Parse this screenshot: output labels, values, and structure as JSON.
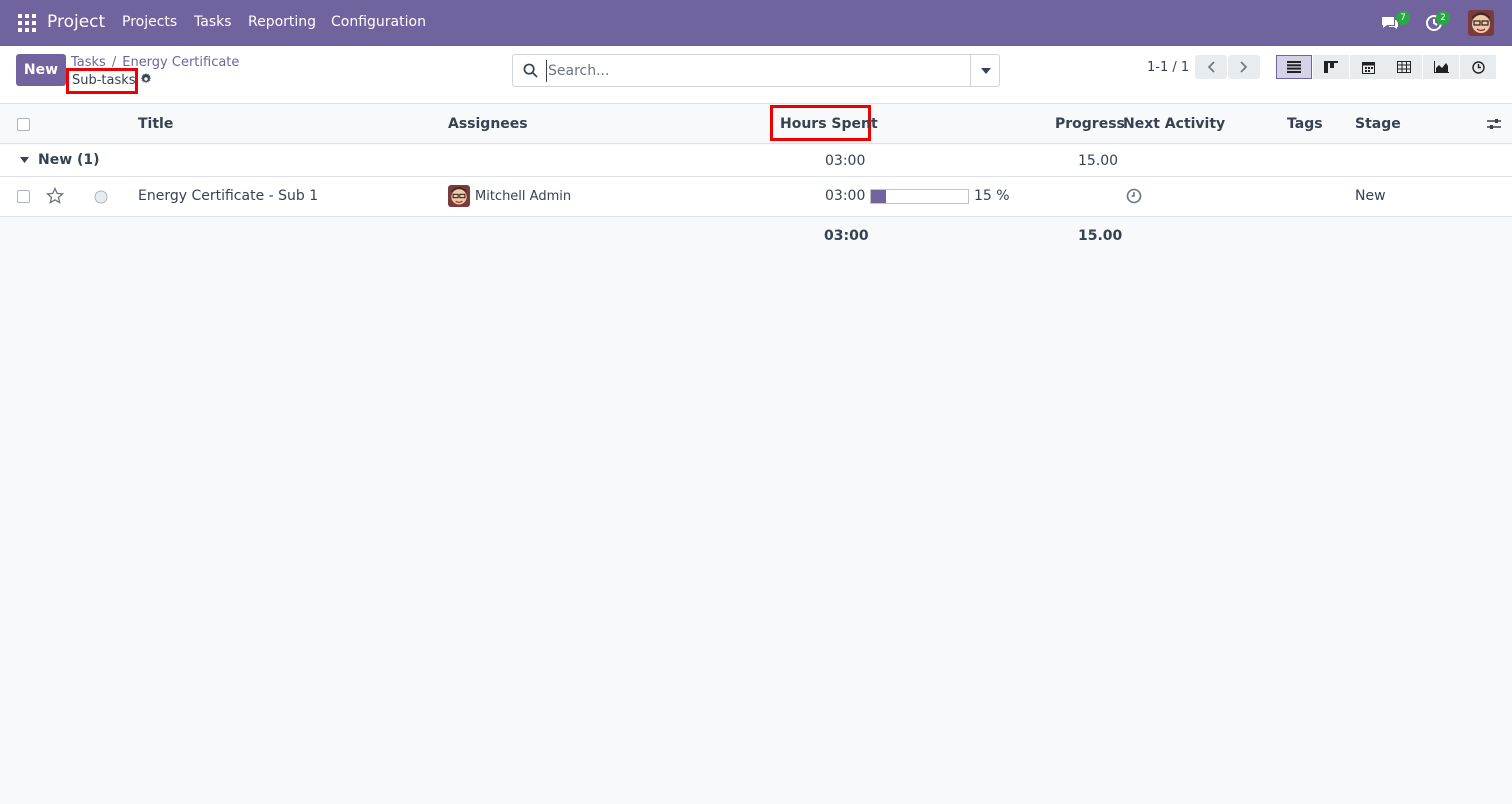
{
  "navbar": {
    "brand": "Project",
    "menu": [
      "Projects",
      "Tasks",
      "Reporting",
      "Configuration"
    ],
    "messages_count": "7",
    "activities_count": "2"
  },
  "control_panel": {
    "new_label": "New",
    "breadcrumb": [
      "Tasks",
      "Energy Certificate"
    ],
    "current": "Sub-tasks",
    "search_placeholder": "Search...",
    "pager": "1-1 / 1"
  },
  "list": {
    "columns": {
      "title": "Title",
      "assignees": "Assignees",
      "hours_spent": "Hours Spent",
      "progress": "Progress",
      "next_activity": "Next Activity",
      "tags": "Tags",
      "stage": "Stage"
    },
    "group": {
      "label": "New (1)",
      "hours": "03:00",
      "progress": "15.00"
    },
    "rows": [
      {
        "title": "Energy Certificate - Sub 1",
        "assignee": "Mitchell Admin",
        "hours": "03:00",
        "progress_label": "15 %",
        "progress_value": 15,
        "stage": "New"
      }
    ],
    "totals": {
      "hours": "03:00",
      "progress": "15.00"
    }
  },
  "colors": {
    "brand": "#71639e",
    "highlight": "#ee0000",
    "badge": "#28a745"
  }
}
